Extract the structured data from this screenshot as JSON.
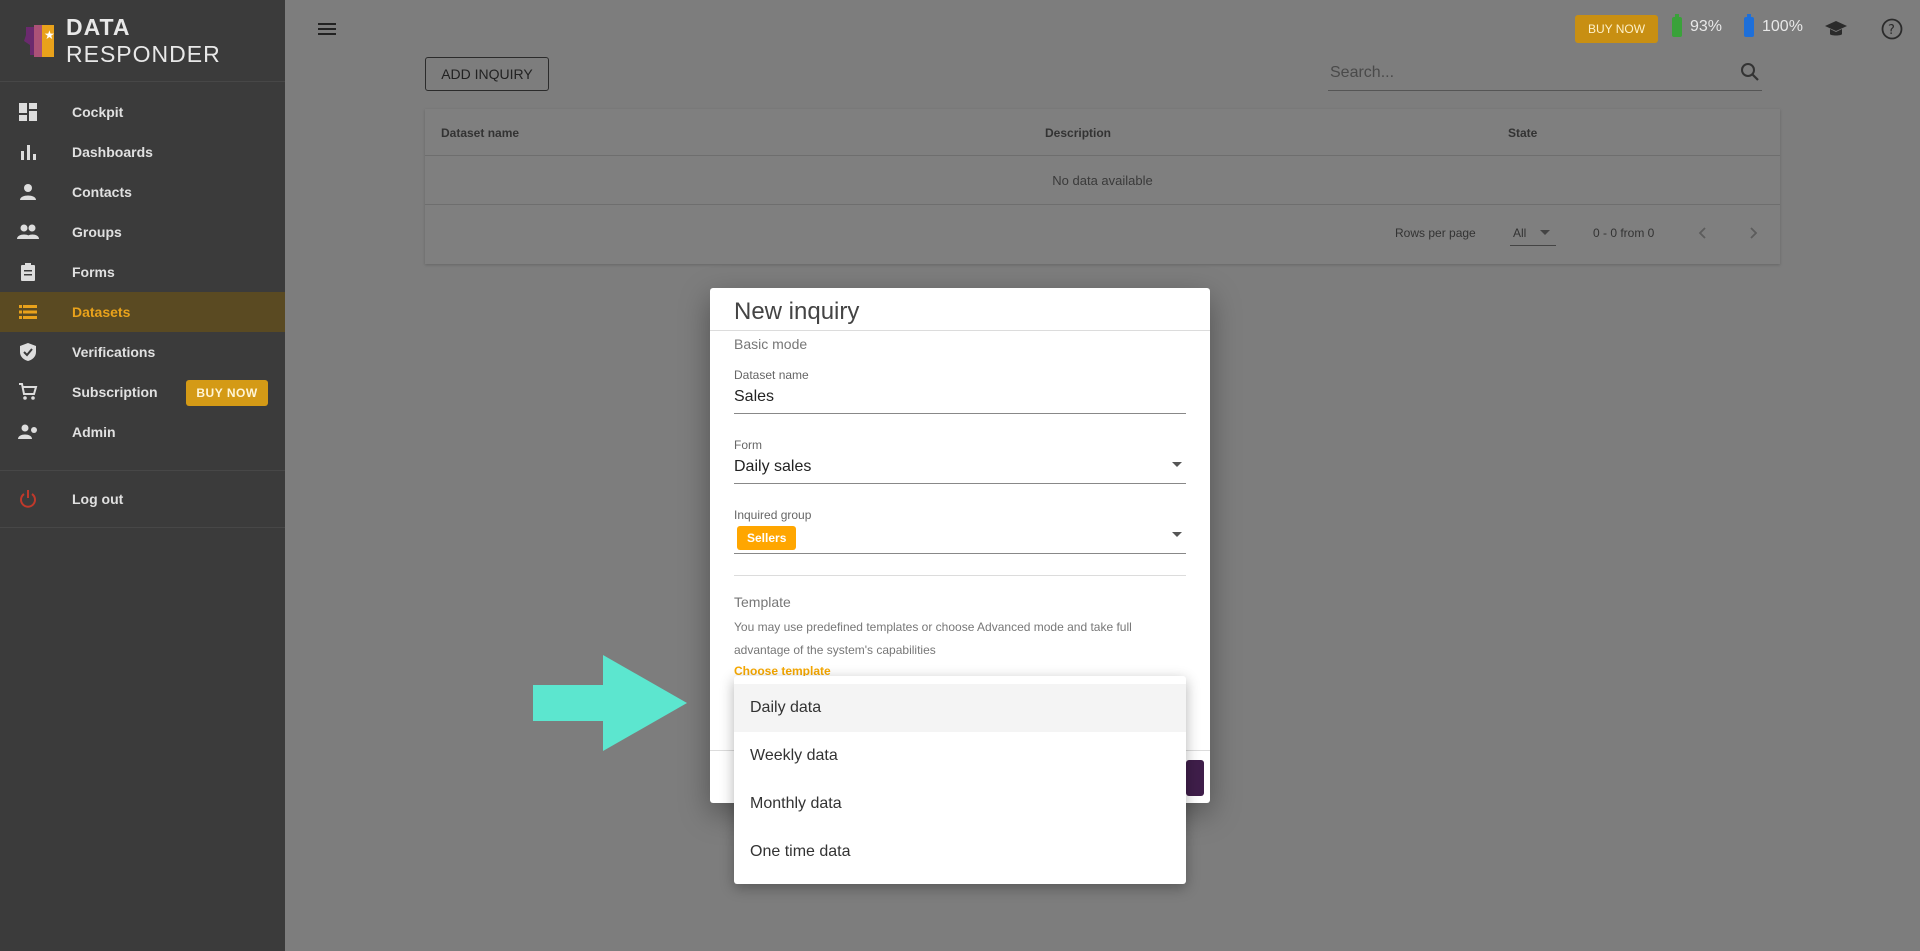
{
  "app": {
    "name_bold": "DATA",
    "name_rest": "RESPONDER",
    "brand_color": "#e9a21b"
  },
  "sidebar": {
    "items": [
      {
        "label": "Cockpit",
        "icon": "dashboard-icon"
      },
      {
        "label": "Dashboards",
        "icon": "bar-chart-icon"
      },
      {
        "label": "Contacts",
        "icon": "person-icon"
      },
      {
        "label": "Groups",
        "icon": "people-icon"
      },
      {
        "label": "Forms",
        "icon": "clipboard-icon"
      },
      {
        "label": "Datasets",
        "icon": "list-icon",
        "active": true
      },
      {
        "label": "Verifications",
        "icon": "shield-check-icon"
      },
      {
        "label": "Subscription",
        "icon": "cart-icon",
        "badge": "BUY NOW"
      },
      {
        "label": "Admin",
        "icon": "admin-icon"
      }
    ],
    "logout": "Log out"
  },
  "topbar": {
    "buy_now": "BUY NOW",
    "battery_green": "93%",
    "battery_blue": "100%"
  },
  "content": {
    "add_button": "ADD INQUIRY",
    "search_placeholder": "Search...",
    "table": {
      "columns": [
        "Dataset name",
        "Description",
        "State"
      ],
      "empty": "No data available",
      "rows_per_page_label": "Rows per page",
      "rows_per_page_value": "All",
      "range": "0 - 0 from 0"
    }
  },
  "dialog": {
    "title": "New inquiry",
    "mode": "Basic mode",
    "dataset_name": {
      "label": "Dataset name",
      "value": "Sales"
    },
    "form": {
      "label": "Form",
      "value": "Daily sales"
    },
    "group": {
      "label": "Inquired group",
      "chip": "Sellers"
    },
    "template": {
      "title": "Template",
      "description": "You may use predefined templates or choose Advanced mode and take full advantage of the system's capabilities",
      "link": "Choose template"
    }
  },
  "menu": {
    "items": [
      "Daily data",
      "Weekly data",
      "Monthly data",
      "One time data"
    ]
  }
}
